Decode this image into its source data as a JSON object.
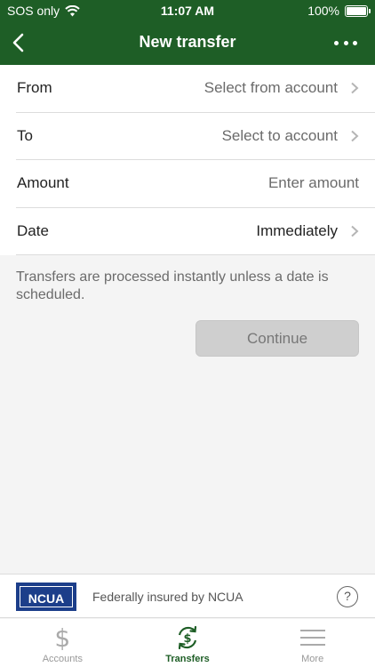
{
  "status_bar": {
    "carrier": "SOS only",
    "time": "11:07 AM",
    "battery": "100%"
  },
  "nav": {
    "title": "New transfer"
  },
  "form": {
    "rows": [
      {
        "label": "From",
        "value": "Select from account"
      },
      {
        "label": "To",
        "value": "Select to account"
      },
      {
        "label": "Amount",
        "placeholder": "Enter amount"
      },
      {
        "label": "Date",
        "value": "Immediately"
      }
    ]
  },
  "note": "Transfers are processed instantly unless a date is scheduled.",
  "continue_label": "Continue",
  "footer": {
    "logo_text": "NCUA",
    "insured_text": "Federally insured by NCUA",
    "help_symbol": "?"
  },
  "tabs": [
    {
      "label": "Accounts",
      "icon": "dollar-icon",
      "active": false
    },
    {
      "label": "Transfers",
      "icon": "transfer-icon",
      "active": true
    },
    {
      "label": "More",
      "icon": "menu-icon",
      "active": false
    }
  ],
  "colors": {
    "brand_green": "#1e5e26",
    "button_disabled": "#cfcfcf",
    "ncua_blue": "#1c3e8a"
  }
}
